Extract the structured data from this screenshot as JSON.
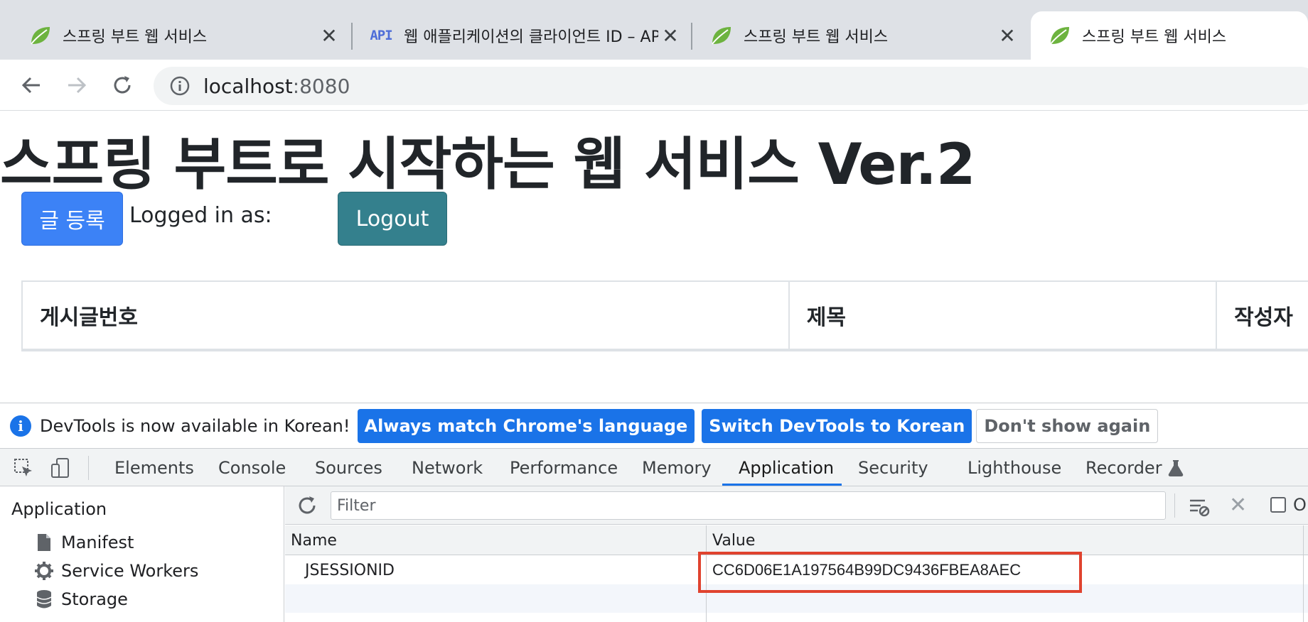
{
  "browser": {
    "tabs": [
      {
        "title": "스프링 부트 웹 서비스",
        "favicon": "spring-leaf-icon",
        "active": false
      },
      {
        "title": "웹 애플리케이션의 클라이언트 ID – API",
        "favicon": "api-icon",
        "favicon_text": "API",
        "active": false
      },
      {
        "title": "스프링 부트 웹 서비스",
        "favicon": "spring-leaf-icon",
        "active": false
      },
      {
        "title": "스프링 부트 웹 서비스",
        "favicon": "spring-leaf-icon",
        "active": true
      }
    ],
    "url_host": "localhost",
    "url_port": ":8080"
  },
  "page": {
    "title": "스프링 부트로 시작하는 웹 서비스 Ver.2",
    "post_button": "글 등록",
    "logged_in_label": "Logged in as:",
    "logout_button": "Logout",
    "table_headers": [
      "게시글번호",
      "제목",
      "작성자"
    ]
  },
  "devtools": {
    "infobar": {
      "message": "DevTools is now available in Korean!",
      "btn_match": "Always match Chrome's language",
      "btn_switch": "Switch DevTools to Korean",
      "btn_dismiss": "Don't show again"
    },
    "tabs": [
      "Elements",
      "Console",
      "Sources",
      "Network",
      "Performance",
      "Memory",
      "Application",
      "Security",
      "Lighthouse",
      "Recorder"
    ],
    "active_tab": "Application",
    "sidebar": {
      "heading": "Application",
      "items": [
        "Manifest",
        "Service Workers",
        "Storage"
      ]
    },
    "cookies": {
      "filter_placeholder": "Filter",
      "only_label": "O",
      "columns": [
        "Name",
        "Value"
      ],
      "rows": [
        {
          "name": "JSESSIONID",
          "value": "CC6D06E1A197564B99DC9436FBEA8AEC"
        }
      ]
    }
  },
  "colors": {
    "primary": "#3c82f6",
    "logout": "#34808d",
    "devtools_blue": "#1a73e8",
    "highlight": "#e0432f"
  }
}
